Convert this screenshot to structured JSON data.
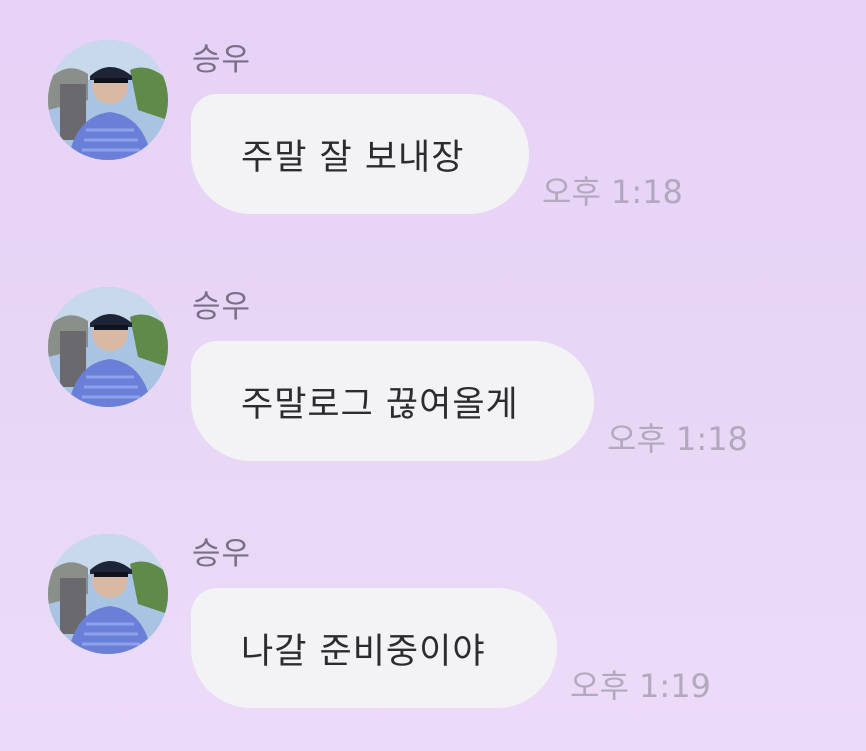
{
  "chat": {
    "messages": [
      {
        "sender": "승우",
        "avatar": "profile-photo",
        "text": "주말 잘 보내장",
        "time": "오후 1:18"
      },
      {
        "sender": "승우",
        "avatar": "profile-photo",
        "text": "주말로그 끊여올게",
        "time": "오후 1:18"
      },
      {
        "sender": "승우",
        "avatar": "profile-photo",
        "text": "나갈 준비중이야",
        "time": "오후 1:19"
      }
    ]
  },
  "colors": {
    "background": "#e8d6f6",
    "bubble": "#f3f3f6",
    "bubble_text": "#2b2b30",
    "sender_text": "#7a6f86",
    "time_text": "#b3a9bf"
  }
}
